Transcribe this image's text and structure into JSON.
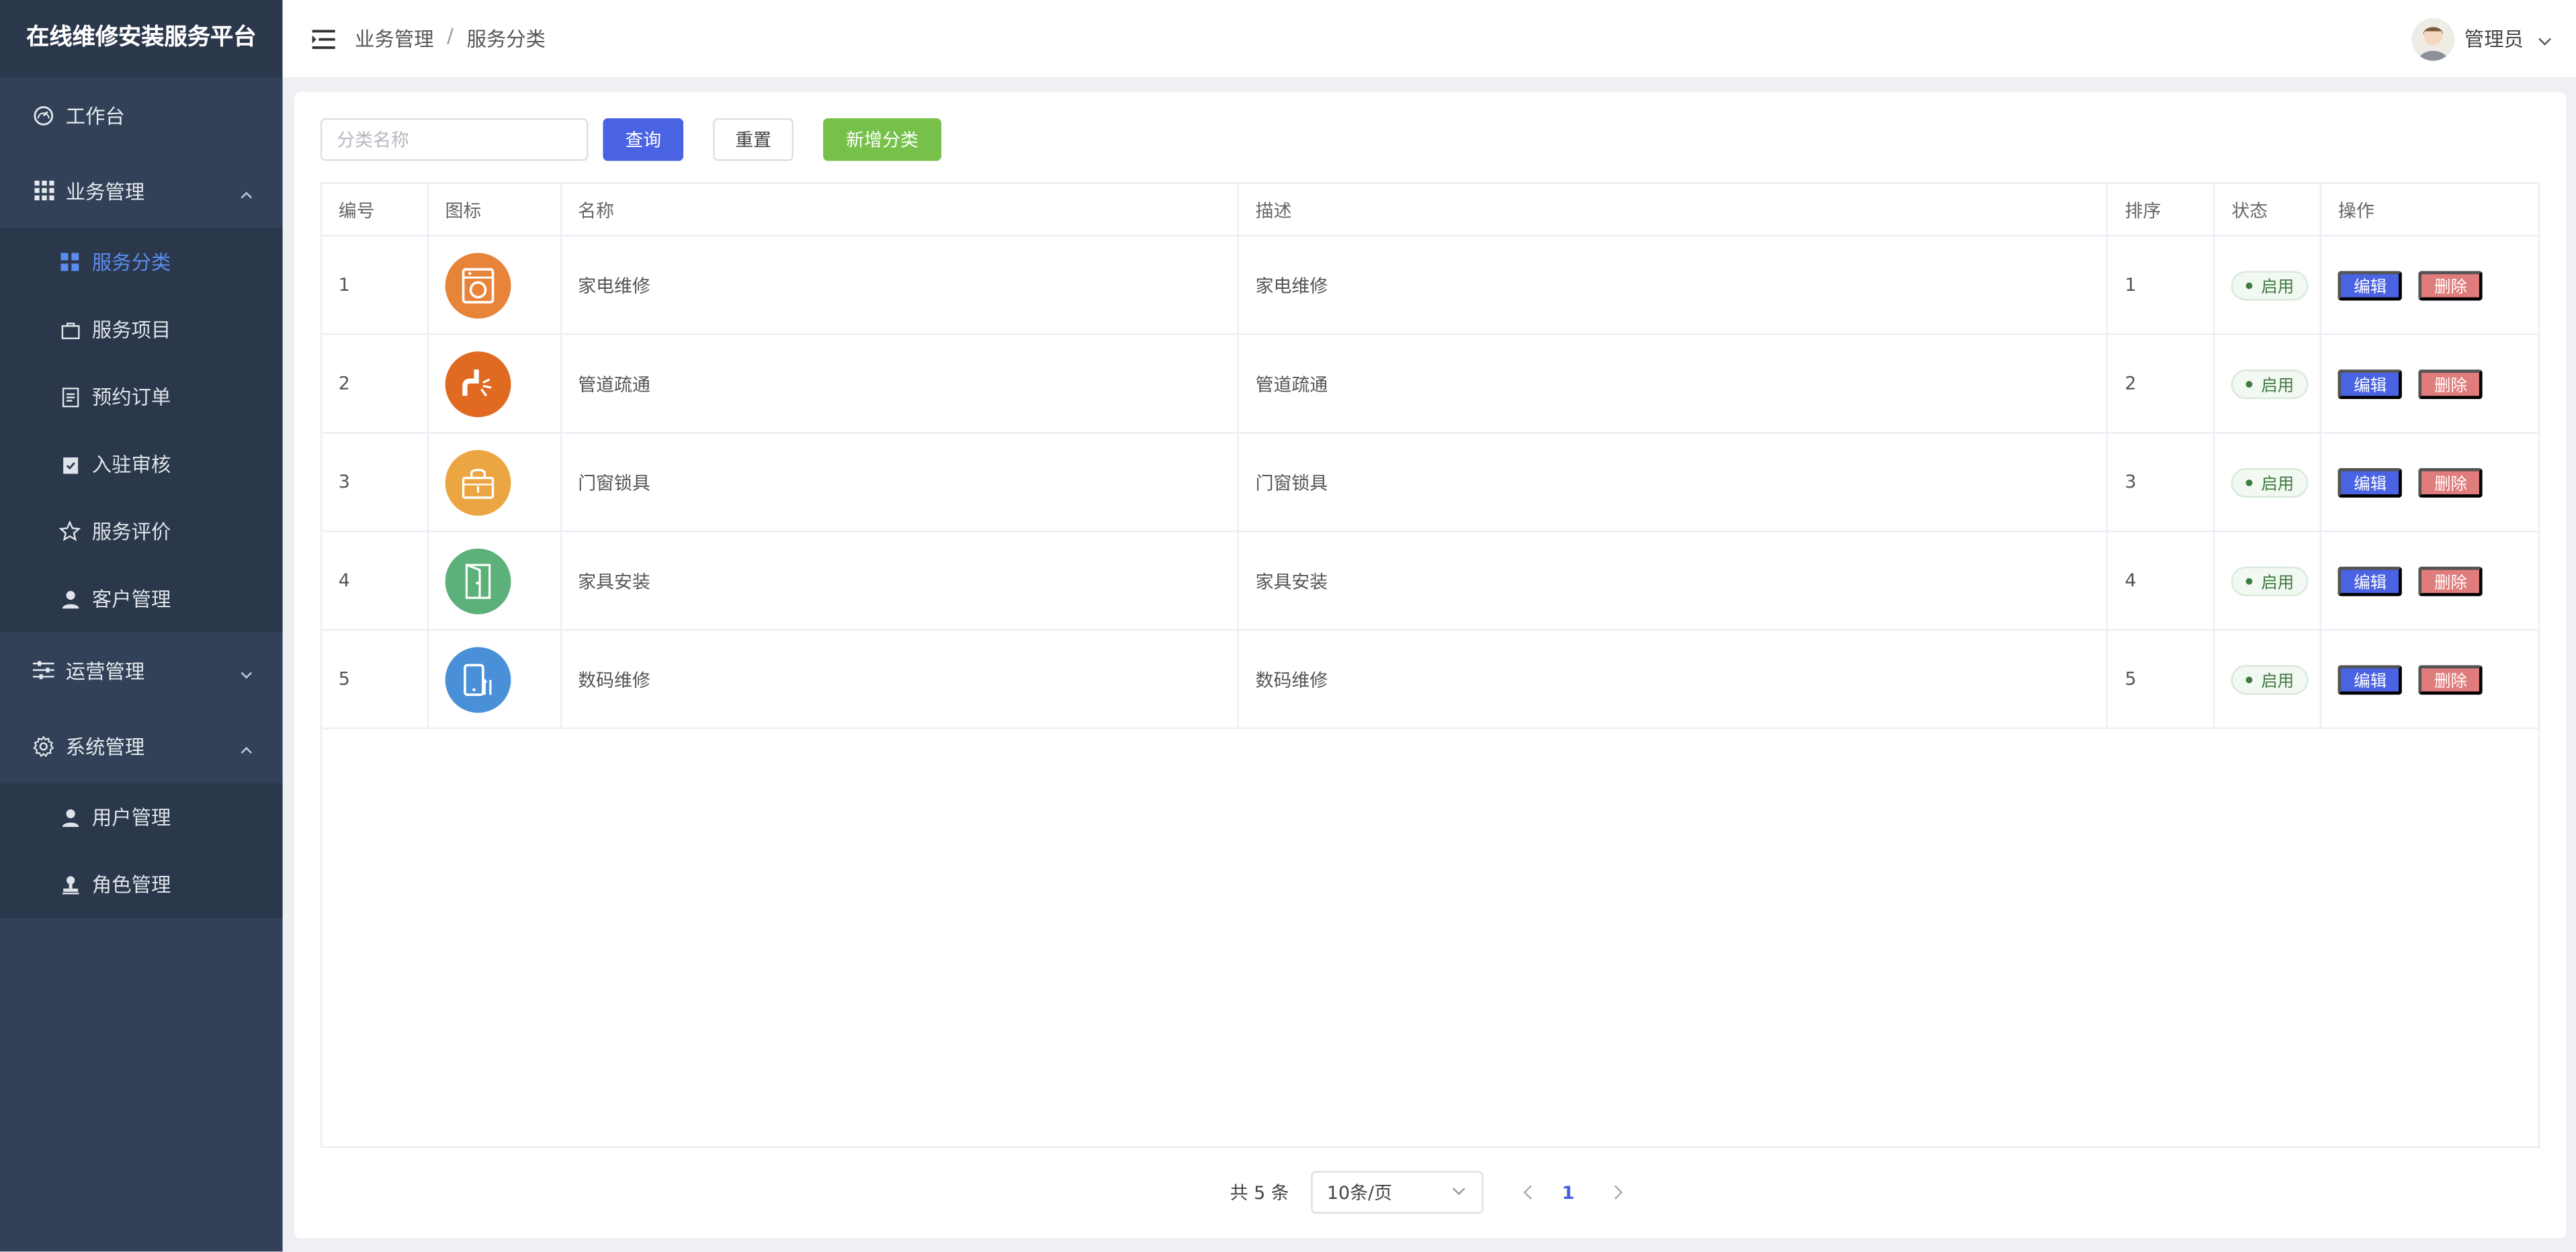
{
  "sidebar": {
    "brand": "在线维修安装服务平台",
    "workbench": "工作台",
    "business": {
      "label": "业务管理",
      "items": [
        "服务分类",
        "服务项目",
        "预约订单",
        "入驻审核",
        "服务评价",
        "客户管理"
      ]
    },
    "operations": "运营管理",
    "system": {
      "label": "系统管理",
      "items": [
        "用户管理",
        "角色管理"
      ]
    }
  },
  "header": {
    "breadcrumb": [
      "业务管理",
      "服务分类"
    ],
    "user": "管理员"
  },
  "toolbar": {
    "search_placeholder": "分类名称",
    "query": "查询",
    "reset": "重置",
    "add": "新增分类"
  },
  "table": {
    "columns": [
      "编号",
      "图标",
      "名称",
      "描述",
      "排序",
      "状态",
      "操作"
    ],
    "rows": [
      {
        "id": "1",
        "icon": "washing-machine-icon",
        "color": "#e8843a",
        "name": "家电维修",
        "desc": "家电维修",
        "sort": "1",
        "status": "启用"
      },
      {
        "id": "2",
        "icon": "pipe-icon",
        "color": "#e06a22",
        "name": "管道疏通",
        "desc": "管道疏通",
        "sort": "2",
        "status": "启用"
      },
      {
        "id": "3",
        "icon": "lock-icon",
        "color": "#eba542",
        "name": "门窗锁具",
        "desc": "门窗锁具",
        "sort": "3",
        "status": "启用"
      },
      {
        "id": "4",
        "icon": "door-icon",
        "color": "#5cb07a",
        "name": "家具安装",
        "desc": "家具安装",
        "sort": "4",
        "status": "启用"
      },
      {
        "id": "5",
        "icon": "phone-repair-icon",
        "color": "#4a90d9",
        "name": "数码维修",
        "desc": "数码维修",
        "sort": "5",
        "status": "启用"
      }
    ],
    "edit": "编辑",
    "delete": "删除"
  },
  "pagination": {
    "total": "共 5 条",
    "page_size": "10条/页",
    "current": "1"
  }
}
